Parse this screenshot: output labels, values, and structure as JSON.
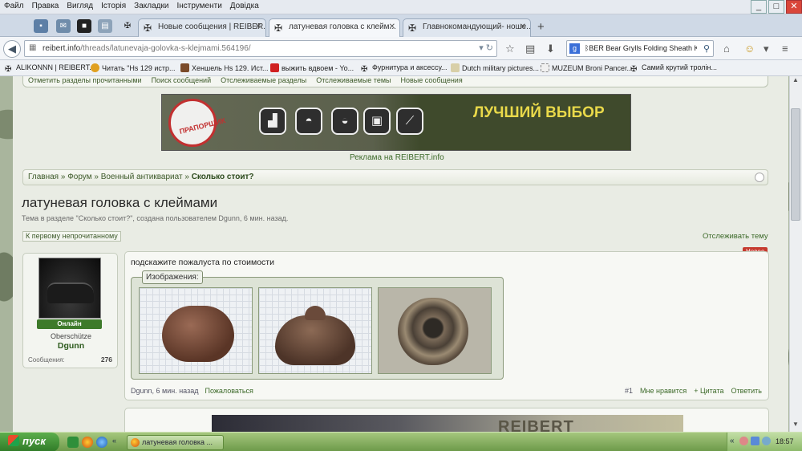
{
  "menubar": {
    "items": [
      "Файл",
      "Правка",
      "Вигляд",
      "Історія",
      "Закладки",
      "Інструменти",
      "Довідка"
    ]
  },
  "window_controls": {
    "minimize": "_",
    "maximize": "□",
    "close": "✕"
  },
  "tabs": [
    {
      "label": "Новые сообщения | REIBER...",
      "icon": "iron-cross-icon"
    },
    {
      "label": "латуневая головка с клейм...",
      "icon": "iron-cross-icon",
      "active": true
    },
    {
      "label": "Главнокомандующий- ноше...",
      "icon": "iron-cross-icon"
    }
  ],
  "new_tab": "+",
  "navbar": {
    "url_host": "reibert.info",
    "url_path": "/threads/latunevaja-golovka-s-klejmami.564196/",
    "search_value": "ᛒBER Bear Grylls Folding Sheath Knife"
  },
  "bookmarks": [
    {
      "label": "ALIKONNN | REIBERT....",
      "color": "#222"
    },
    {
      "label": "Читать \"Нs 129 истр...",
      "color": "#e0a020"
    },
    {
      "label": "Хеншель Нs 129. Ист...",
      "color": "#7a4a2a"
    },
    {
      "label": "выжить вдвоем - Yo...",
      "color": "#d02020"
    },
    {
      "label": "Фурнитура и аксессу...",
      "color": "#222"
    },
    {
      "label": "Dutch military pictures...",
      "color": "#d8cfa8"
    },
    {
      "label": "MUZEUM Broni Pancer...",
      "color": "#f0f0f0"
    },
    {
      "label": "Самий крутий тролін...",
      "color": "#222"
    }
  ],
  "quicklinks": [
    "Отметить разделы прочитанными",
    "Поиск сообщений",
    "Отслеживаемые разделы",
    "Отслеживаемые темы",
    "Новые сообщения"
  ],
  "banner": {
    "stamp_text": "ПРАПОРЩИК",
    "slogan": "ЛУЧШИЙ ВЫБОР",
    "ad_label": "Реклама на REIBERT.info"
  },
  "breadcrumb": {
    "items": [
      "Главная",
      "Форум",
      "Военный антиквариат"
    ],
    "current": "Сколько стоит?",
    "separator": "»"
  },
  "thread": {
    "title": "латуневая головка с клеймами",
    "subtitle": "Тема в разделе \"Сколько стоит?\", создана пользователем Dgunn, 6 мин. назад.",
    "first_unread_button": "К первому непрочитанному",
    "watch_link": "Отслеживать тему"
  },
  "user": {
    "status": "Онлайн",
    "rank": "Oberschütze",
    "name": "Dgunn",
    "messages_label": "Сообщения:",
    "messages_count": "276"
  },
  "post": {
    "new_badge": "Новое",
    "text": "подскажите пожалуста по стоимости",
    "attachments_label": "Изображения:",
    "author_time": "Dgunn, 6 мин. назад",
    "report": "Пожаловаться",
    "number": "#1",
    "like": "Мне нравится",
    "quote": "+ Цитата",
    "reply": "Ответить"
  },
  "next_banner": {
    "text": "REIBERT"
  },
  "taskbar": {
    "start_label": "пуск",
    "window_item": "латуневая головка ...",
    "clock": "18:57"
  }
}
